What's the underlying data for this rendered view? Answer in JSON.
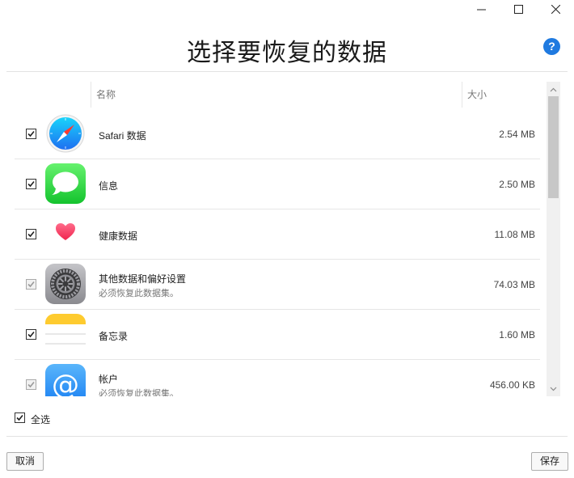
{
  "window": {
    "minimize_icon": "minimize-icon",
    "maximize_icon": "maximize-icon",
    "close_icon": "close-icon"
  },
  "title": "选择要恢复的数据",
  "help_icon_label": "?",
  "columns": {
    "name": "名称",
    "size": "大小"
  },
  "rows": [
    {
      "name": "Safari 数据",
      "subtitle": "",
      "size": "2.54 MB",
      "checked": true,
      "disabled": false,
      "icon": "safari-icon"
    },
    {
      "name": "信息",
      "subtitle": "",
      "size": "2.50 MB",
      "checked": true,
      "disabled": false,
      "icon": "messages-icon"
    },
    {
      "name": "健康数据",
      "subtitle": "",
      "size": "11.08 MB",
      "checked": true,
      "disabled": false,
      "icon": "health-heart-icon"
    },
    {
      "name": "其他数据和偏好设置",
      "subtitle": "必须恢复此数据集。",
      "size": "74.03 MB",
      "checked": true,
      "disabled": true,
      "icon": "settings-gear-icon"
    },
    {
      "name": "备忘录",
      "subtitle": "",
      "size": "1.60 MB",
      "checked": true,
      "disabled": false,
      "icon": "notes-icon"
    },
    {
      "name": "帐户",
      "subtitle": "必须恢复此数据集。",
      "size": "456.00 KB",
      "checked": true,
      "disabled": true,
      "icon": "accounts-at-icon"
    }
  ],
  "select_all": {
    "label": "全选",
    "checked": true
  },
  "buttons": {
    "cancel": "取消",
    "save": "保存"
  },
  "colors": {
    "accent": "#1f7ae0",
    "messages_green": "#3ccf4e",
    "heart_red": "#f0345a",
    "notes_yellow": "#fecb2f"
  }
}
